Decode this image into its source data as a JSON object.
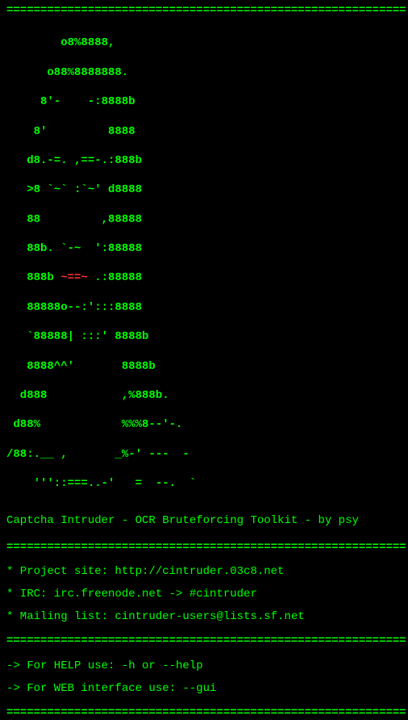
{
  "separator": "===========================================================",
  "ascii_art": {
    "l01": "        o8%8888,",
    "l02": "      o88%8888888.",
    "l03": "     8'-    -:8888b",
    "l04": "    8'         8888",
    "l05": "   d8.-=. ,==-.:888b",
    "l06": "   >8 `~` :`~' d8888",
    "l07": "   88         ,88888",
    "l08": "   88b. `-~  ':88888",
    "l09_pre": "   888b ",
    "l09_red": "~==~",
    "l09_post": " .:88888",
    "l10": "   88888o--:':::8888",
    "l11": "   `88888| :::' 8888b",
    "l12": "   8888^^'       8888b",
    "l13": "  d888           ,%888b.",
    "l14": " d88%            %%%8--'-.",
    "l15": "/88:.__ ,       _%-' ---  -",
    "l16": "    '''::===..-'   =  --.  `"
  },
  "title": "Captcha Intruder - OCR Bruteforcing Toolkit - by psy",
  "info": {
    "project": "* Project site: http://cintruder.03c8.net",
    "irc": "* IRC: irc.freenode.net -> #cintruder",
    "mailing": "* Mailing list: cintruder-users@lists.sf.net"
  },
  "help": {
    "cli": " -> For HELP use: -h or --help",
    "web": " -> For WEB interface use: --gui"
  }
}
